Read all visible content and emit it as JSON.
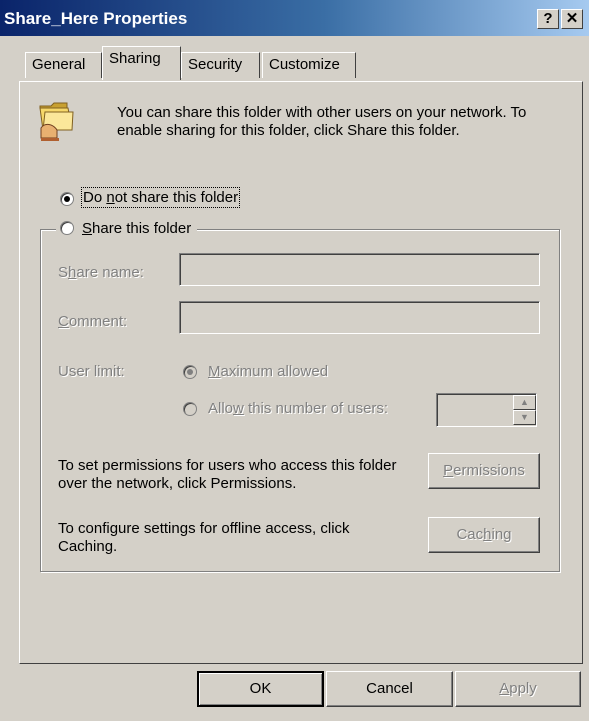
{
  "window": {
    "title": "Share_Here Properties"
  },
  "titlebar": {
    "help_label": "?",
    "close_label": "✕"
  },
  "tabs": [
    {
      "label": "General"
    },
    {
      "label": "Sharing"
    },
    {
      "label": "Security"
    },
    {
      "label": "Customize"
    }
  ],
  "info": {
    "text": "You can share this folder with other users on your network.  To enable sharing for this folder, click Share this folder."
  },
  "radios": {
    "do_not_share": {
      "pre": "Do ",
      "key": "n",
      "post": "ot share this folder",
      "checked": true
    },
    "share": {
      "pre": "",
      "key": "S",
      "post": "hare this folder",
      "checked": false
    }
  },
  "share_name": {
    "pre": "S",
    "key": "h",
    "post": "are name:",
    "value": ""
  },
  "comment": {
    "pre": "",
    "key": "C",
    "post": "omment:",
    "value": ""
  },
  "user_limit": {
    "label": "User limit:",
    "maximum": {
      "pre": "",
      "key": "M",
      "post": "aximum allowed",
      "checked": true
    },
    "allow": {
      "pre": "Allo",
      "key": "w",
      "post": " this number of users:",
      "checked": false
    },
    "count": ""
  },
  "permissions": {
    "text": "To set permissions for users who access this folder over the network, click Permissions.",
    "button": {
      "pre": "",
      "key": "P",
      "post": "ermissions"
    }
  },
  "caching": {
    "text": "To configure settings for offline access, click Caching.",
    "button": {
      "pre": "Cac",
      "key": "h",
      "post": "ing"
    }
  },
  "footer": {
    "ok_label": "OK",
    "cancel_label": "Cancel",
    "apply": {
      "pre": "",
      "key": "A",
      "post": "pply"
    }
  },
  "icons": {
    "folder": "shared-folder-icon"
  },
  "colors": {
    "titlebar_start": "#0a246a",
    "titlebar_end": "#a6caf0",
    "face": "#d4d0c8",
    "disabled_text": "#808080"
  }
}
